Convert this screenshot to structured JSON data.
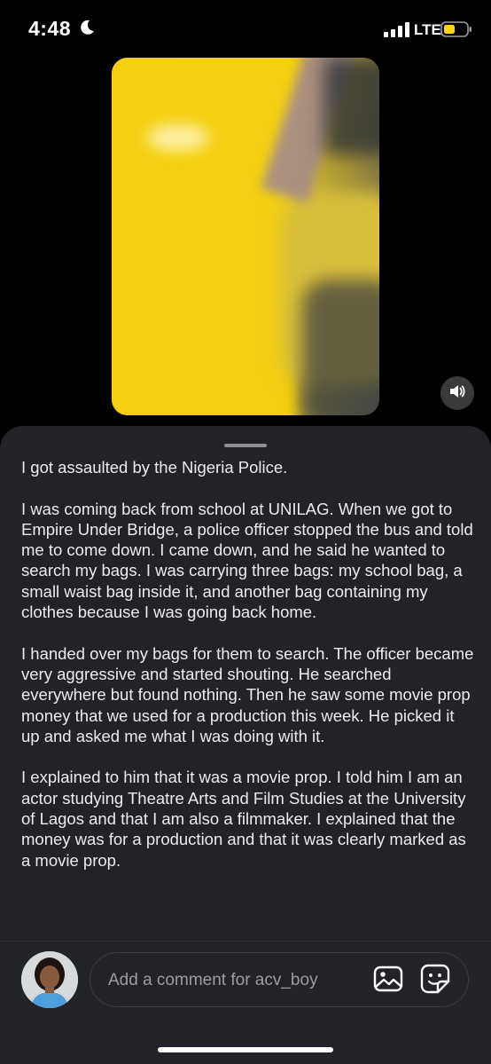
{
  "status_bar": {
    "time": "4:48",
    "network": "LTE",
    "icons": [
      "moon-icon",
      "signal-icon",
      "battery-icon"
    ],
    "battery_color": "#ffd60a"
  },
  "video": {
    "sound_icon": "speaker-icon"
  },
  "caption": {
    "paragraphs": [
      "I got assaulted by the Nigeria Police.",
      "I was coming back from school at UNILAG. When we got to Empire Under Bridge, a police officer stopped the bus and told me to come down. I came down, and he said he wanted to search my bags. I was carrying three bags: my school bag, a small waist bag inside it, and another bag containing my clothes because I was going back home.",
      "I handed over my bags for them to search. The officer became very aggressive and started shouting. He searched everywhere but found nothing. Then he saw some movie prop money that we used for a production this week. He picked it up and asked me what I was doing with it.",
      "I explained to him that it was a movie prop. I told him I am an actor studying Theatre Arts and Film Studies at the University of Lagos and that I am also a filmmaker. I explained that the money was for a production and that it was clearly marked as a movie prop."
    ]
  },
  "comment_bar": {
    "placeholder": "Add a comment for acv_boy",
    "gallery_icon": "gallery-icon",
    "sticker_icon": "sticker-icon"
  },
  "colors": {
    "background": "#000000",
    "sheet": "#212328",
    "text": "#ececec",
    "placeholder": "#9a9ca2"
  }
}
